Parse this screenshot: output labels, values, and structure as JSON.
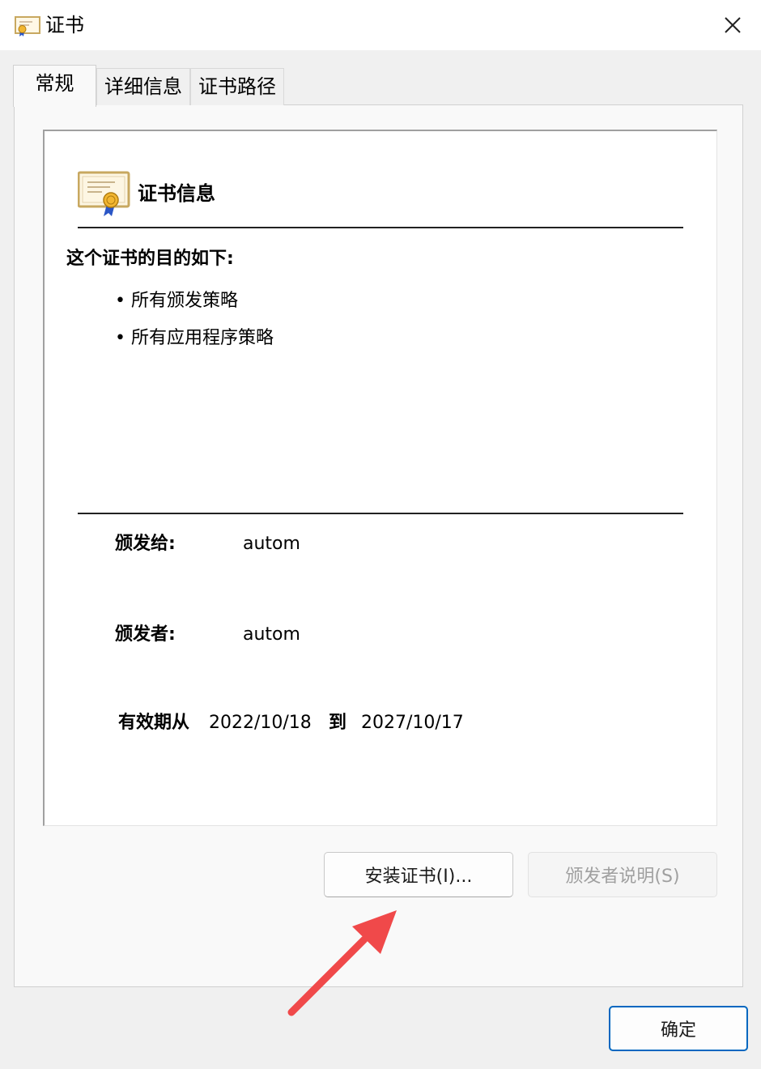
{
  "window": {
    "title": "证书",
    "title_icon": "certificate-icon",
    "close_icon": "close-icon"
  },
  "tabs": [
    {
      "label": "常规",
      "active": true
    },
    {
      "label": "详细信息",
      "active": false
    },
    {
      "label": "证书路径",
      "active": false
    }
  ],
  "general": {
    "info_title": "证书信息",
    "purpose_heading": "这个证书的目的如下:",
    "purposes": [
      "所有颁发策略",
      "所有应用程序策略"
    ],
    "issued_to_label": "颁发给:",
    "issued_to_value": "autom",
    "issued_by_label": "颁发者:",
    "issued_by_value": "autom",
    "valid_from_label": "有效期从",
    "valid_from": "2022/10/18",
    "valid_to_label": "到",
    "valid_to": "2027/10/17"
  },
  "buttons": {
    "install": "安装证书(I)...",
    "issuer_statement": "颁发者说明(S)",
    "ok": "确定"
  },
  "annotation": {
    "arrow_color": "#f0494a",
    "points_to": "install"
  },
  "colors": {
    "accent": "#0067c0",
    "disabled_text": "#a0a0a0"
  }
}
